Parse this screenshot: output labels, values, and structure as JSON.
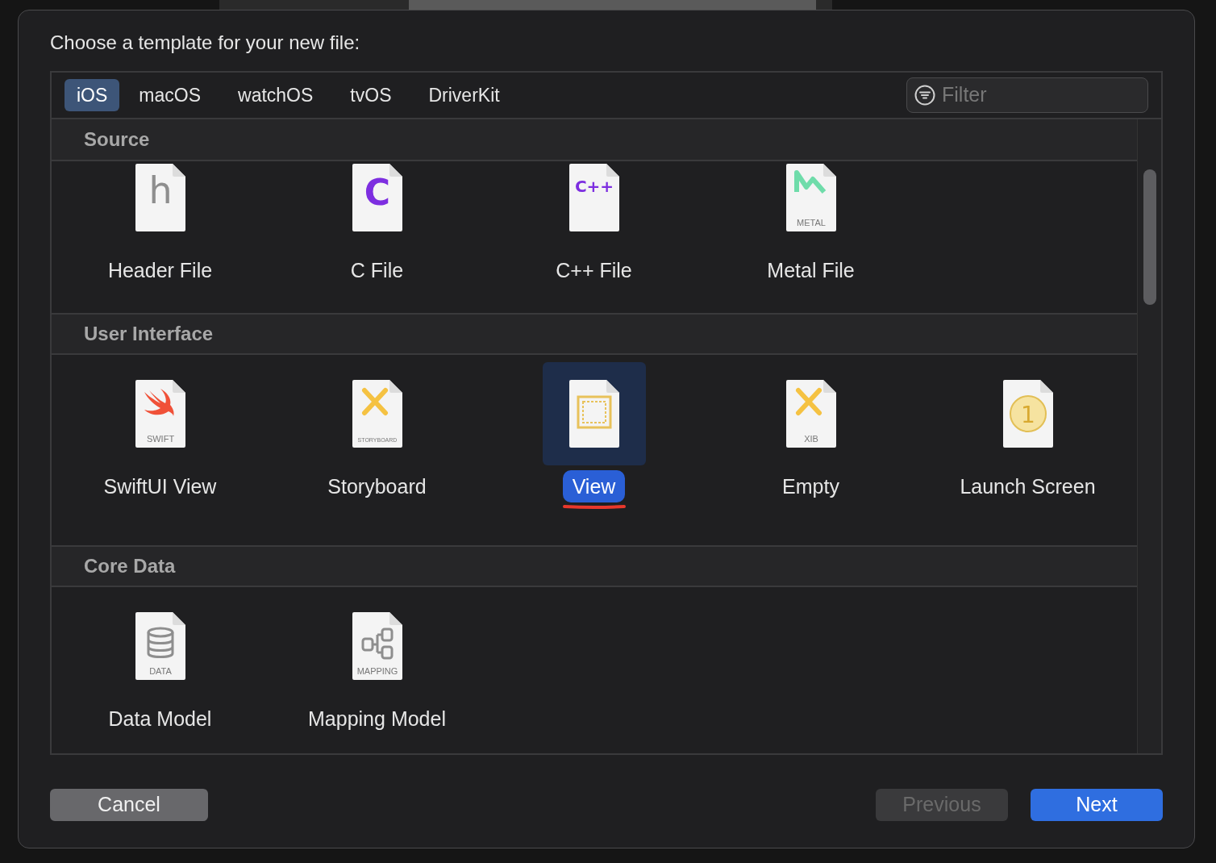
{
  "dialog": {
    "title": "Choose a template for your new file:"
  },
  "tabs": [
    {
      "label": "iOS",
      "selected": true
    },
    {
      "label": "macOS",
      "selected": false
    },
    {
      "label": "watchOS",
      "selected": false
    },
    {
      "label": "tvOS",
      "selected": false
    },
    {
      "label": "DriverKit",
      "selected": false
    }
  ],
  "filter": {
    "placeholder": "Filter"
  },
  "sections": [
    {
      "title": "Source",
      "scrolled": true,
      "items": [
        {
          "name": "Header File",
          "kind": "header",
          "glyph": "h",
          "selected": false
        },
        {
          "name": "C File",
          "kind": "c",
          "glyph": "C",
          "selected": false
        },
        {
          "name": "C++ File",
          "kind": "cpp",
          "glyph": "C++",
          "selected": false
        },
        {
          "name": "Metal File",
          "kind": "metal",
          "caption": "METAL",
          "selected": false
        }
      ]
    },
    {
      "title": "User Interface",
      "scrolled": false,
      "items": [
        {
          "name": "SwiftUI View",
          "kind": "swift",
          "caption": "SWIFT",
          "selected": false
        },
        {
          "name": "Storyboard",
          "kind": "storyboard",
          "caption": "STORYBOARD",
          "selected": false
        },
        {
          "name": "View",
          "kind": "view",
          "selected": true
        },
        {
          "name": "Empty",
          "kind": "xib",
          "caption": "XIB",
          "selected": false
        },
        {
          "name": "Launch Screen",
          "kind": "launch",
          "glyph": "1",
          "selected": false
        }
      ]
    },
    {
      "title": "Core Data",
      "scrolled": false,
      "items": [
        {
          "name": "Data Model",
          "kind": "data",
          "caption": "DATA",
          "selected": false
        },
        {
          "name": "Mapping Model",
          "kind": "mapping",
          "caption": "MAPPING",
          "selected": false
        }
      ]
    }
  ],
  "buttons": [
    {
      "label": "Cancel",
      "kind": "cancel",
      "disabled": false
    },
    {
      "label": "Previous",
      "kind": "previous",
      "disabled": true
    },
    {
      "label": "Next",
      "kind": "next",
      "disabled": false
    }
  ]
}
